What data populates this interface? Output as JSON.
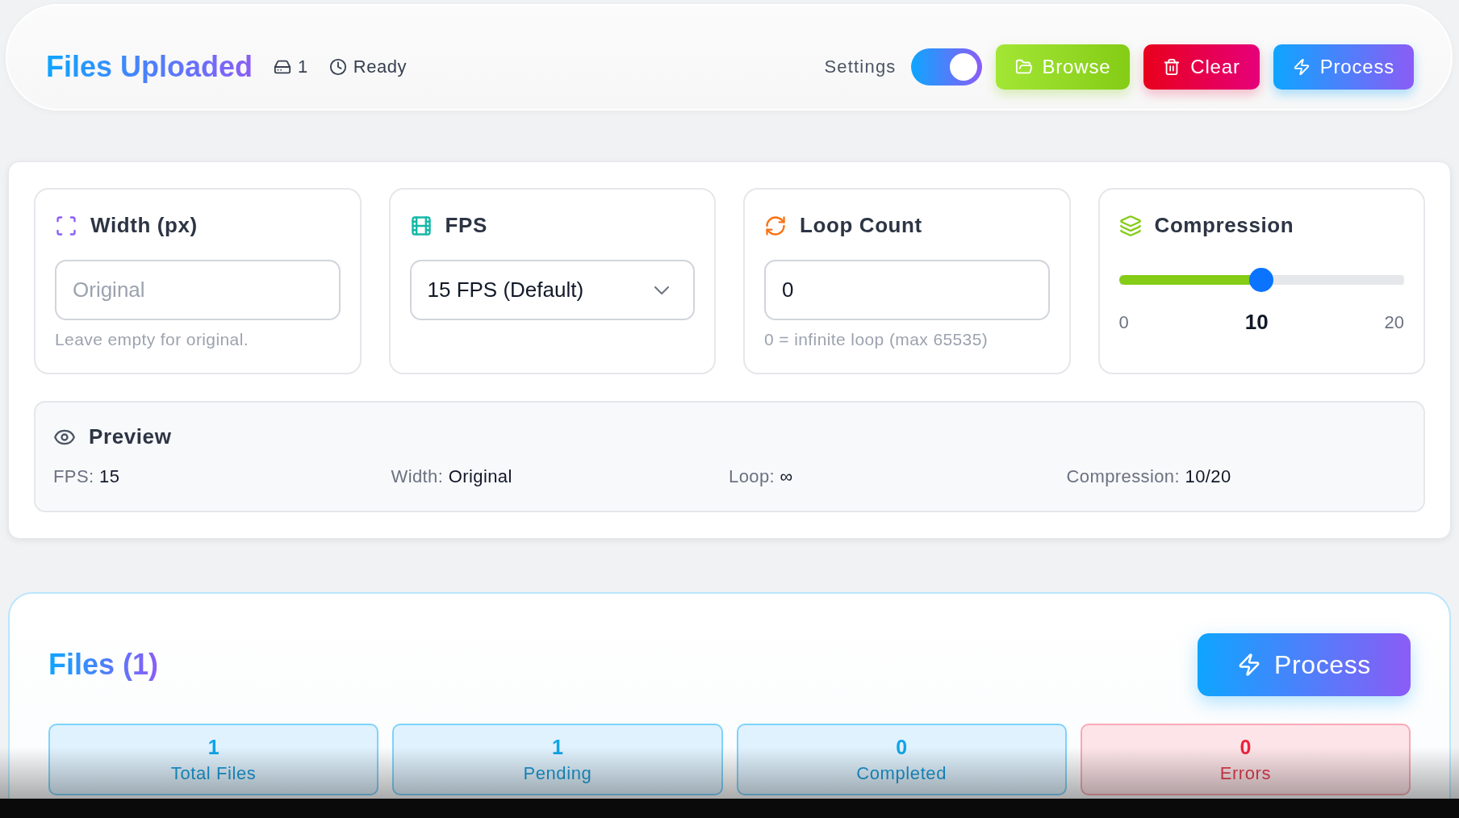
{
  "header": {
    "title": "Files Uploaded",
    "file_count": "1",
    "status": "Ready",
    "settings_label": "Settings",
    "settings_toggle": {
      "on": true
    },
    "buttons": [
      {
        "kind": "browse",
        "label": "Browse"
      },
      {
        "kind": "clear",
        "label": "Clear"
      },
      {
        "kind": "process",
        "label": "Process"
      }
    ]
  },
  "settings": {
    "cards": [
      {
        "kind": "input",
        "title": "Width (px)",
        "placeholder": "Original",
        "help": "Leave empty for original."
      },
      {
        "kind": "select",
        "title": "FPS",
        "value": "15 FPS (Default)"
      },
      {
        "kind": "input",
        "title": "Loop Count",
        "value": "0",
        "help": "0 = infinite loop (max 65535)"
      },
      {
        "kind": "slider",
        "title": "Compression",
        "level": 0.5,
        "min_label": "0",
        "value_label": "10",
        "max_label": "20"
      }
    ],
    "preview": {
      "title": "Preview",
      "items": [
        {
          "label": "FPS:",
          "value": "15"
        },
        {
          "label": "Width:",
          "value": "Original"
        },
        {
          "label": "Loop:",
          "value": "∞"
        },
        {
          "label": "Compression:",
          "value": "10/20"
        }
      ]
    }
  },
  "files": {
    "title": "Files (1)",
    "process_button": "Process",
    "stats": [
      {
        "kind": "count",
        "value": "1",
        "label": "Total Files"
      },
      {
        "kind": "count",
        "value": "1",
        "label": "Pending"
      },
      {
        "kind": "count",
        "value": "0",
        "label": "Completed"
      },
      {
        "kind": "error",
        "value": "0",
        "label": "Errors"
      }
    ]
  }
}
